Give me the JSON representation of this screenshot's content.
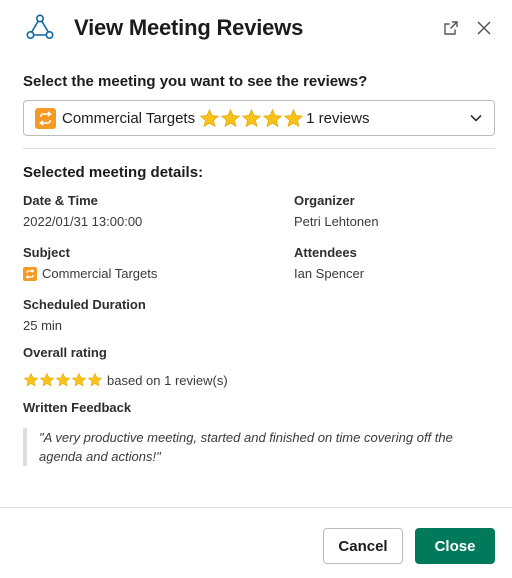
{
  "dialog": {
    "title": "View Meeting Reviews",
    "icons": {
      "logo": "triangle-nodes-logo",
      "external": "open-external-icon",
      "close": "close-icon"
    }
  },
  "selector": {
    "prompt": "Select the meeting you want to see the reviews?",
    "selected_meeting": "Commercial Targets",
    "selected_rating_stars": 5,
    "selected_reviews": "1 reviews",
    "icon": "repeat-emoji-icon"
  },
  "details": {
    "section_title": "Selected meeting details:",
    "date_time_label": "Date & Time",
    "date_time_value": "2022/01/31 13:00:00",
    "organizer_label": "Organizer",
    "organizer_value": "Petri Lehtonen",
    "subject_label": "Subject",
    "subject_value": "Commercial Targets",
    "attendees_label": "Attendees",
    "attendees_value": "Ian Spencer",
    "duration_label": "Scheduled Duration",
    "duration_value": "25 min",
    "overall_label": "Overall rating",
    "overall_stars": 5,
    "overall_text": "based on 1 review(s)",
    "feedback_label": "Written Feedback",
    "feedback_text": "\"A very productive meeting, started and finished on time covering off the agenda and actions!\""
  },
  "footer": {
    "cancel_label": "Cancel",
    "close_label": "Close"
  },
  "colors": {
    "primary": "#007a5a",
    "star": "#f8c21b",
    "emoji_bg": "#f59a23"
  }
}
